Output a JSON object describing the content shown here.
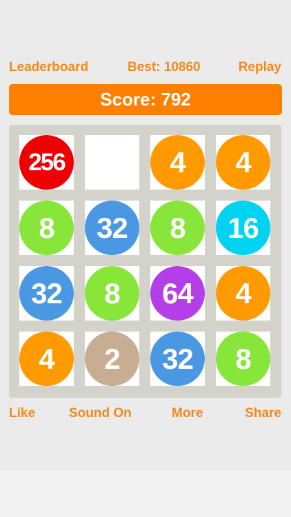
{
  "header": {
    "leaderboard_label": "Leaderboard",
    "best_label": "Best: 10860",
    "replay_label": "Replay"
  },
  "score": {
    "label": "Score: 792"
  },
  "board": {
    "tiles": [
      {
        "value": "256",
        "color": "#ee0000"
      },
      {
        "value": "",
        "color": ""
      },
      {
        "value": "4",
        "color": "#ff9a00"
      },
      {
        "value": "4",
        "color": "#ff9a00"
      },
      {
        "value": "8",
        "color": "#88e53a"
      },
      {
        "value": "32",
        "color": "#4a97e4"
      },
      {
        "value": "8",
        "color": "#88e53a"
      },
      {
        "value": "16",
        "color": "#00d2f2"
      },
      {
        "value": "32",
        "color": "#4a97e4"
      },
      {
        "value": "8",
        "color": "#88e53a"
      },
      {
        "value": "64",
        "color": "#b43ee8"
      },
      {
        "value": "4",
        "color": "#ff9a00"
      },
      {
        "value": "4",
        "color": "#ff9a00"
      },
      {
        "value": "2",
        "color": "#c8ad92"
      },
      {
        "value": "32",
        "color": "#4a97e4"
      },
      {
        "value": "8",
        "color": "#88e53a"
      }
    ]
  },
  "footer": {
    "like_label": "Like",
    "sound_label": "Sound On",
    "more_label": "More",
    "share_label": "Share"
  },
  "colors": {
    "accent": "#ff8000",
    "link": "#f08a1c",
    "board_bg": "#d3d3cc"
  }
}
